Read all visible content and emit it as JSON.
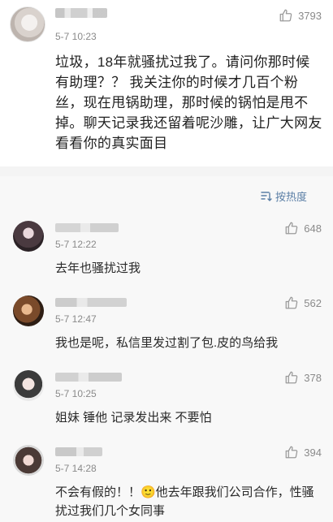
{
  "main_comment": {
    "time": "5-7 10:23",
    "likes": "3793",
    "text": "垃圾，18年就骚扰过我了。请问你那时候有助理？？ 我关注你的时候才几百个粉丝，现在甩锅助理，那时候的锅怕是甩不掉。聊天记录我还留着呢沙雕，让广大网友看看你的真实面目"
  },
  "sort": {
    "label": "按热度"
  },
  "replies": [
    {
      "time": "5-7 12:22",
      "likes": "648",
      "text": "去年也骚扰过我"
    },
    {
      "time": "5-7 12:47",
      "likes": "562",
      "text": "我也是呢，私信里发过割了包.皮的鸟给我"
    },
    {
      "time": "5-7 10:25",
      "likes": "378",
      "text": "姐妹 锤他 记录发出来 不要怕"
    },
    {
      "time": "5-7 14:28",
      "likes": "394",
      "text": "不会有假的！！🙂他去年跟我们公司合作，性骚扰过我们几个女同事"
    }
  ],
  "colors": {
    "accent": "#5b7fa6",
    "muted": "#8a8a8a",
    "reply_bg": "#f8f8f8"
  }
}
